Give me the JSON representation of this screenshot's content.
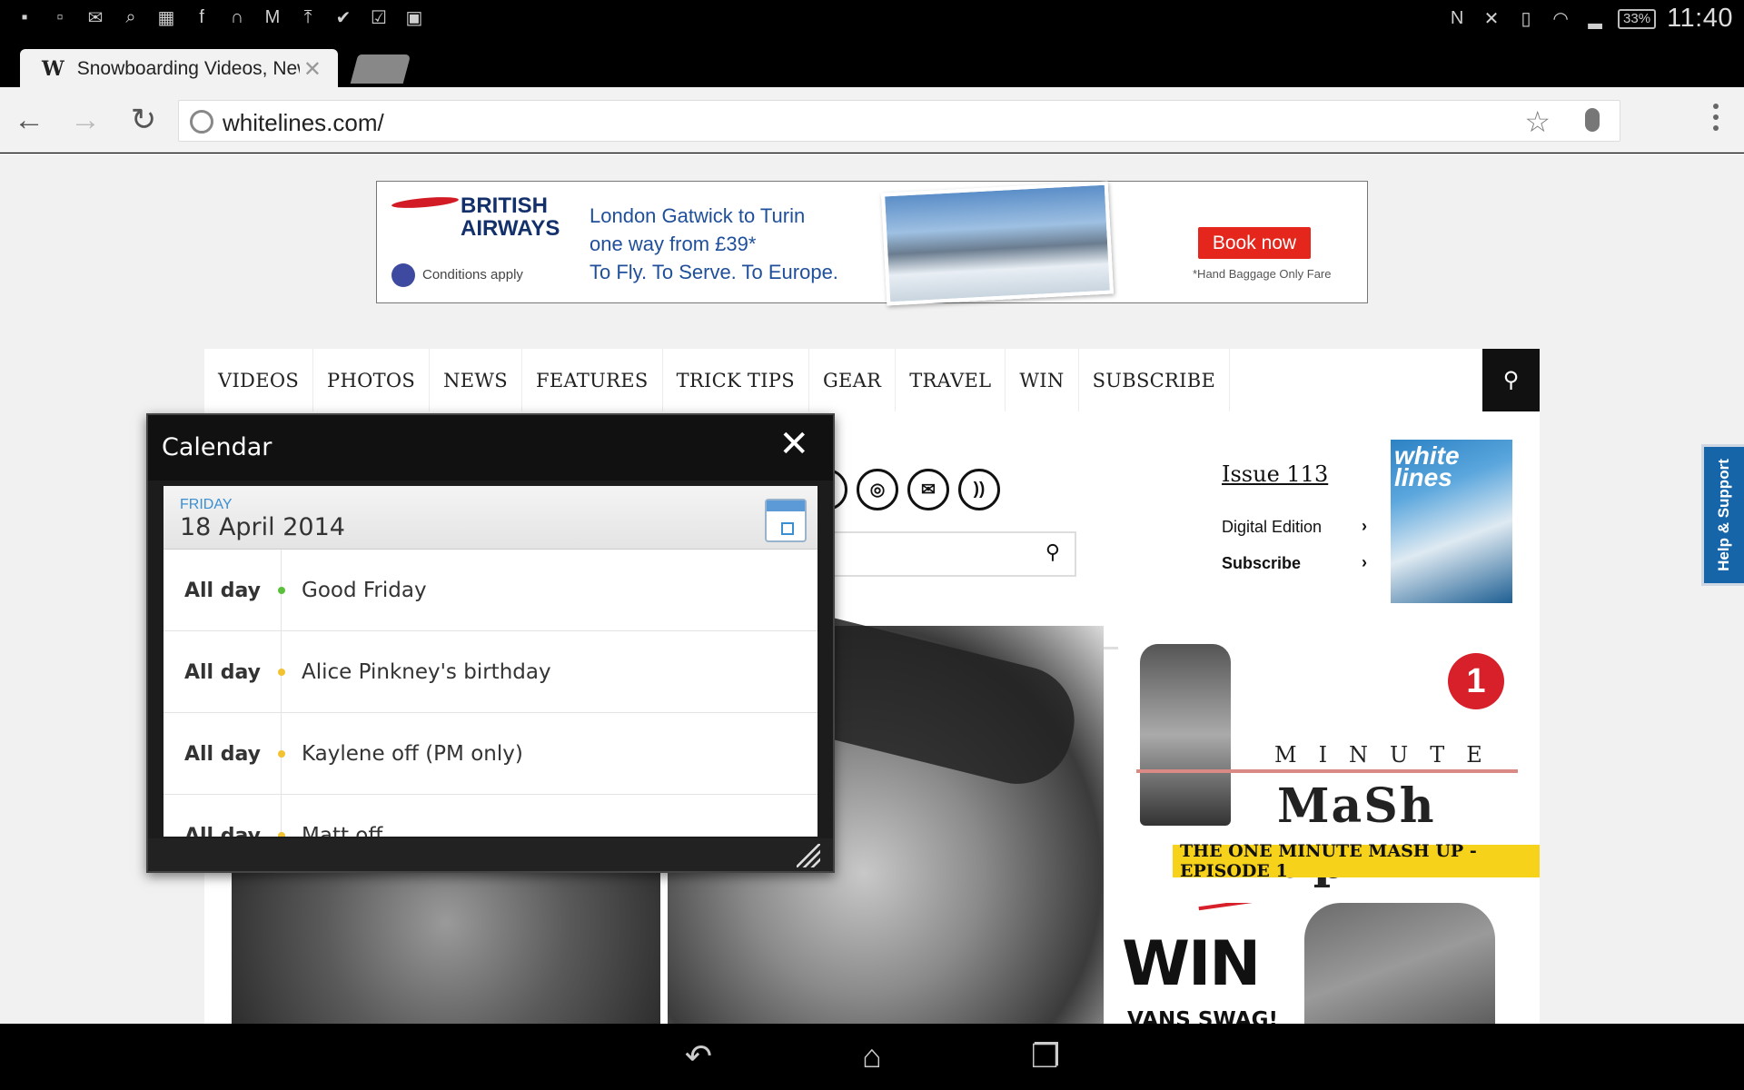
{
  "status_bar": {
    "notif_icons": [
      "chat-icon",
      "clipboard-icon",
      "mail-x-icon",
      "find-icon",
      "calendar-grid-icon",
      "facebook-icon",
      "headphones-icon",
      "gmail-icon",
      "upload-icon",
      "check-icon",
      "tasks-icon",
      "shopping-icon"
    ],
    "battery": "33%",
    "time": "11:40"
  },
  "browser": {
    "tab_title": "Snowboarding Videos, News",
    "tab_favicon": "W",
    "url": "whitelines.com/"
  },
  "ad": {
    "brand_line1": "BRITISH",
    "brand_line2": "AIRWAYS",
    "conditions": "Conditions apply",
    "copy_line1": "London Gatwick to Turin",
    "copy_line2": "one way from £39*",
    "copy_line3": "To Fly. To Serve. To Europe.",
    "cta": "Book now",
    "footnote": "*Hand Baggage Only Fare"
  },
  "nav": {
    "items": [
      "VIDEOS",
      "PHOTOS",
      "NEWS",
      "FEATURES",
      "TRICK TIPS",
      "GEAR",
      "TRAVEL",
      "WIN",
      "SUBSCRIBE"
    ]
  },
  "social": [
    "twitter-icon",
    "instagram-icon",
    "email-icon",
    "rss-icon"
  ],
  "issue": {
    "title": "Issue 113",
    "digital": "Digital Edition",
    "subscribe": "Subscribe",
    "chevron": "›",
    "cover_text": "white lines"
  },
  "promo": {
    "mashup_number": "1",
    "mashup_word": "MINUTE",
    "mashup_big": "MaSh up",
    "mashup_caption": "THE ONE MINUTE MASH UP - EPISODE 1",
    "win_title": "WIN",
    "win_sub": "VANS SWAG!"
  },
  "help_tab": "Help & Support",
  "calendar": {
    "title": "Calendar",
    "day_of_week": "FRIDAY",
    "date": "18 April 2014",
    "events": [
      {
        "when": "All day",
        "what": "Good Friday",
        "color": "#5cbf3c"
      },
      {
        "when": "All day",
        "what": "Alice Pinkney's birthday",
        "color": "#f2c230"
      },
      {
        "when": "All day",
        "what": "Kaylene off (PM only)",
        "color": "#f2c230"
      },
      {
        "when": "All day",
        "what": "Matt off",
        "color": "#f2c230"
      }
    ]
  }
}
